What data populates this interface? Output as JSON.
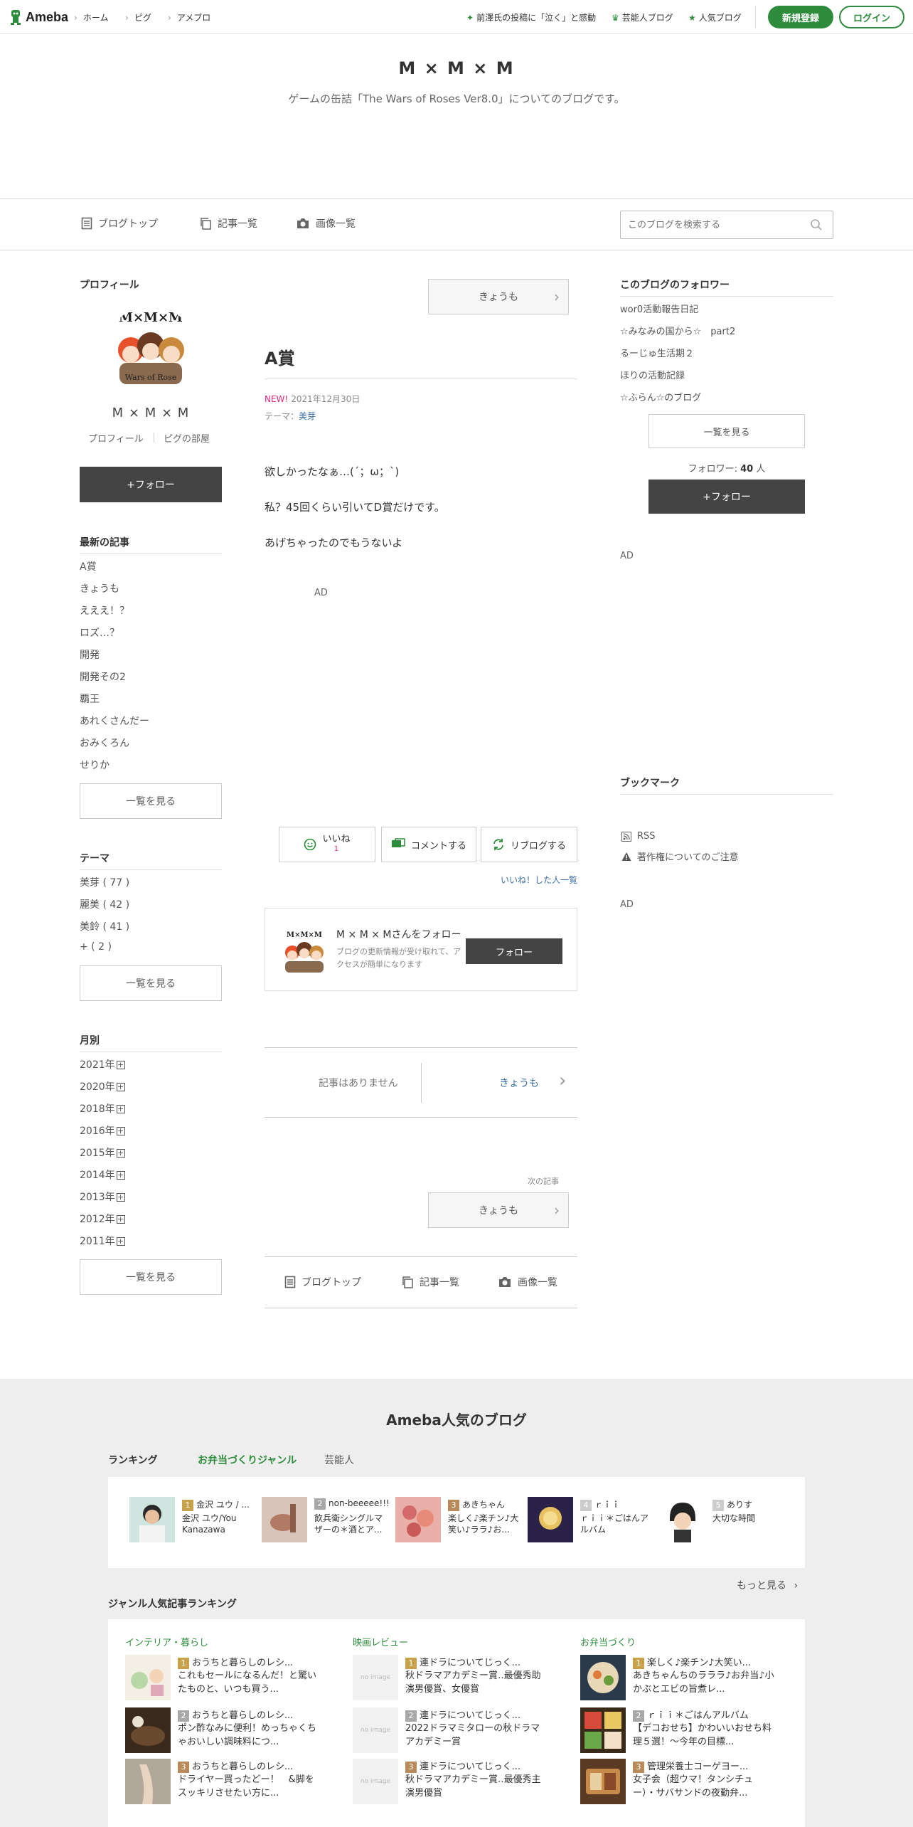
{
  "header": {
    "logo": "Ameba",
    "nav": [
      "ホーム",
      "ピグ",
      "アメブロ"
    ],
    "links": [
      "前澤氏の投稿に「泣く」と感動",
      "芸能人ブログ",
      "人気ブログ"
    ],
    "signup": "新規登録",
    "login": "ログイン"
  },
  "blog": {
    "title": "M × M × M",
    "description": "ゲームの缶詰「The Wars of Roses Ver8.0」についてのブログです。"
  },
  "navbar": {
    "items": [
      "ブログトップ",
      "記事一覧",
      "画像一覧"
    ],
    "search_placeholder": "このブログを検索する"
  },
  "profile": {
    "heading": "プロフィール",
    "name": "M × M × M",
    "link1": "プロフィール",
    "link2": "ピグの部屋",
    "follow": "+フォロー",
    "avatar_caption": "M×M×M",
    "avatar_sub": "Wars of Rose"
  },
  "recent": {
    "heading": "最新の記事",
    "items": [
      "A賞",
      "きょうも",
      "えええ！？",
      "ロズ…？",
      "開発",
      "開発その2",
      "覇王",
      "あれくさんだー",
      "おみくろん",
      "せりか"
    ],
    "more": "一覧を見る"
  },
  "theme": {
    "heading": "テーマ",
    "items": [
      "美芽 ( 77 )",
      "麗美 ( 42 )",
      "美鈴 ( 41 )",
      "+ ( 2 )"
    ],
    "more": "一覧を見る"
  },
  "monthly": {
    "heading": "月別",
    "items": [
      "2021年",
      "2020年",
      "2018年",
      "2016年",
      "2015年",
      "2014年",
      "2013年",
      "2012年",
      "2011年"
    ],
    "more": "一覧を見る"
  },
  "article": {
    "prev_label": "きょうも",
    "title": "A賞",
    "new_badge": "NEW!",
    "date": "2021年12月30日",
    "theme_label": "テーマ：",
    "theme": "美芽",
    "body": [
      "欲しかったなぁ…(´；ω；`)",
      "私？45回くらい引いてD賞だけです。",
      "あげちゃったのでもうないよ"
    ],
    "ad": "AD",
    "like": "いいね",
    "like_count": "1",
    "comment": "コメントする",
    "reblog": "リブログする",
    "liked_list": "いいね！した人一覧",
    "follow_card_title": "M × M × Mさんをフォロー",
    "follow_card_desc": "ブログの更新情報が受け取れて、アクセスが簡単になります",
    "follow_card_btn": "フォロー",
    "no_article": "記事はありません",
    "next_link": "きょうも",
    "next_label": "次の記事",
    "next_btn": "きょうも",
    "bottom_nav": [
      "ブログトップ",
      "記事一覧",
      "画像一覧"
    ]
  },
  "right": {
    "followers_heading": "このブログのフォロワー",
    "followers": [
      "wor0活動報告日記",
      "☆みなみの国から☆　part2",
      "るーじゅ生活期２",
      "ほりの活動記録",
      "☆ふらん☆のブログ"
    ],
    "more": "一覧を見る",
    "follower_count_label": "フォロワー:",
    "follower_count": "40",
    "follower_count_unit": "人",
    "follow": "+フォロー",
    "ad1": "AD",
    "bookmark_heading": "ブックマーク",
    "rss": "RSS",
    "copyright": "著作権についてのご注意",
    "ad2": "AD"
  },
  "footer": {
    "title": "Ameba人気のブログ",
    "ranking_label": "ランキング",
    "tabs": [
      "お弁当づくりジャンル",
      "芸能人"
    ],
    "ranking": [
      {
        "rank": "1",
        "name": "金沢 ユウ / ...",
        "desc": "金沢 ユウ/You Kanazawa",
        "color": "#c8a14b"
      },
      {
        "rank": "2",
        "name": "non-beeeee!!!",
        "desc": "飲兵衛シングルマザーの＊酒とア...",
        "color": "#a8a8a8"
      },
      {
        "rank": "3",
        "name": "あきちゃん",
        "desc": "楽しく♪楽チン♪大笑い♪ララ♪お...",
        "color": "#b98a5a"
      },
      {
        "rank": "4",
        "name": "ｒｉｉ",
        "desc": "ｒｉｉ＊ごはんアルバム",
        "color": "#cccccc"
      },
      {
        "rank": "5",
        "name": "ありす",
        "desc": "大切な時間",
        "color": "#cccccc"
      }
    ],
    "more": "もっと見る",
    "genre_heading": "ジャンル人気記事ランキング",
    "genres": [
      {
        "name": "インテリア・暮らし",
        "items": [
          {
            "rank": "1",
            "title": "おうちと暮らしのレシ...",
            "text": "これもセールになるんだ！と驚いたものと、いつも買う..."
          },
          {
            "rank": "2",
            "title": "おうちと暮らしのレシ...",
            "text": "ポン酢なみに便利！めっちゃくちゃおいしい調味料につ..."
          },
          {
            "rank": "3",
            "title": "おうちと暮らしのレシ...",
            "text": "ドライヤー買ったどー！　&脚をスッキリさせたい方に..."
          }
        ]
      },
      {
        "name": "映画レビュー",
        "items": [
          {
            "rank": "1",
            "title": "連ドラについてじっく...",
            "text": "秋ドラマアカデミー賞‥最優秀助演男優賞、女優賞"
          },
          {
            "rank": "2",
            "title": "連ドラについてじっく...",
            "text": "2022ドラマミタローの秋ドラマアカデミー賞"
          },
          {
            "rank": "3",
            "title": "連ドラについてじっく...",
            "text": "秋ドラマアカデミー賞‥最優秀主演男優賞"
          }
        ]
      },
      {
        "name": "お弁当づくり",
        "items": [
          {
            "rank": "1",
            "title": "楽しく♪楽チン♪大笑い...",
            "text": "あきちゃんちのラララ♪お弁当♪小かぶとエビの旨煮レ..."
          },
          {
            "rank": "2",
            "title": "ｒｉｉ＊ごはんアルバム",
            "text": "【デコおせち】かわいいおせち料理５選！～今年の目標..."
          },
          {
            "rank": "3",
            "title": "管理栄養士コーゲヨー...",
            "text": "女子会（超ウマ！タンシチュー）・サバサンドの夜勤弁..."
          }
        ]
      }
    ],
    "no_image": "no image"
  },
  "colors": {
    "brand_green": "#2d8c3c",
    "link_blue": "#3a6ea5",
    "new_pink": "#e0287a",
    "dark_button": "#444444"
  }
}
